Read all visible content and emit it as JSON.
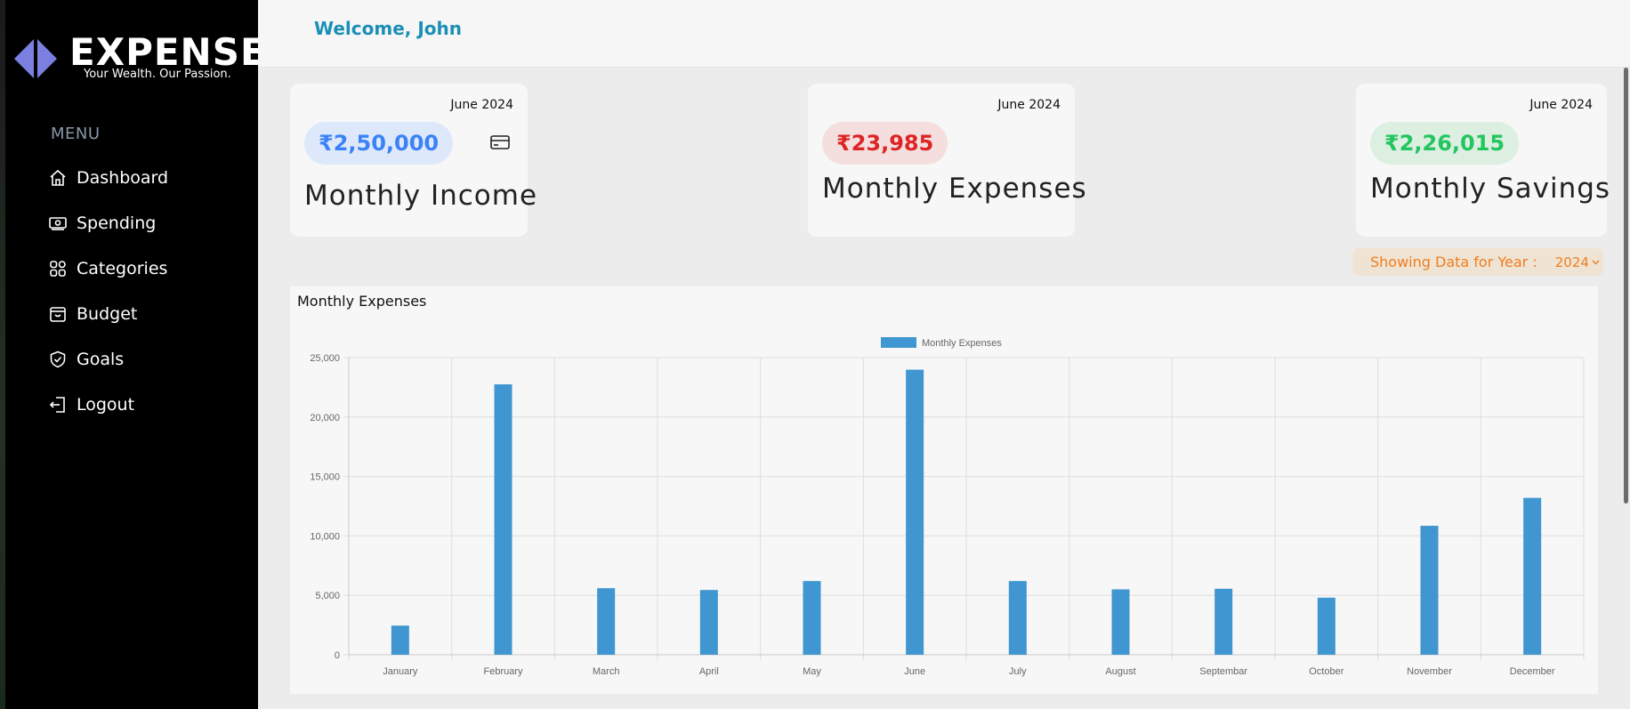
{
  "brand": {
    "name": "EXPENSE",
    "tagline": "Your Wealth. Our Passion.",
    "colors": {
      "sidebar_bg": "#000000",
      "logo_mark": "#7b7fe0",
      "accent": "#1b8fb5"
    }
  },
  "sidebar": {
    "menu_title": "MENU",
    "items": [
      {
        "label": "Dashboard",
        "icon": "home-icon"
      },
      {
        "label": "Spending",
        "icon": "cash-icon"
      },
      {
        "label": "Categories",
        "icon": "grid-icon"
      },
      {
        "label": "Budget",
        "icon": "wallet-icon"
      },
      {
        "label": "Goals",
        "icon": "shield-check-icon"
      },
      {
        "label": "Logout",
        "icon": "logout-icon"
      }
    ]
  },
  "header": {
    "welcome": "Welcome, John"
  },
  "cards": [
    {
      "date": "June 2024",
      "amount": "₹2,50,000",
      "title": "Monthly Income",
      "amount_color": "#3b82f6",
      "pill_bg": "#dde8fb",
      "icon": "card-icon"
    },
    {
      "date": "June 2024",
      "amount": "₹23,985",
      "title": "Monthly Expenses",
      "amount_color": "#dc2626",
      "pill_bg": "#f5dede"
    },
    {
      "date": "June 2024",
      "amount": "₹2,26,015",
      "title": "Monthly Savings",
      "amount_color": "#22c55e",
      "pill_bg": "#dcefe1"
    }
  ],
  "year_filter": {
    "label": "Showing Data for Year :",
    "selected": "2024",
    "color": "#ef7d1f"
  },
  "chart_section": {
    "title": "Monthly Expenses"
  },
  "chart_data": {
    "type": "bar",
    "categories": [
      "January",
      "February",
      "March",
      "April",
      "May",
      "June",
      "July",
      "August",
      "Septembar",
      "October",
      "November",
      "December"
    ],
    "series": [
      {
        "name": "Monthly Expenses",
        "color": "#4096d0",
        "values": [
          2450,
          22750,
          5600,
          5450,
          6200,
          23985,
          6200,
          5500,
          5550,
          4800,
          10850,
          13200
        ]
      }
    ],
    "ylim": [
      0,
      25000
    ],
    "yticks": [
      0,
      5000,
      10000,
      15000,
      20000,
      25000
    ],
    "ytick_labels": [
      "0",
      "5,000",
      "10,000",
      "15,000",
      "20,000",
      "25,000"
    ],
    "grid": true,
    "legend": "top-center"
  }
}
